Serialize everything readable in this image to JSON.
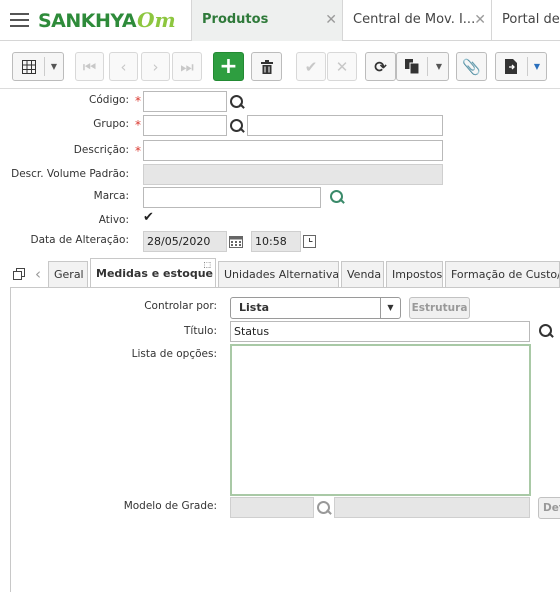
{
  "header": {
    "logo_main": "SANKHYA",
    "logo_suffix": "Om",
    "tabs": [
      {
        "label": "Produtos",
        "active": true
      },
      {
        "label": "Central de Mov. I...",
        "active": false
      },
      {
        "label": "Portal de M",
        "active": false
      }
    ],
    "close_glyph": "✕"
  },
  "toolbar": {
    "buttons": [
      "grid-view",
      "first",
      "previous",
      "next",
      "last",
      "add",
      "delete",
      "confirm",
      "cancel",
      "refresh",
      "duplicate",
      "attach",
      "export"
    ],
    "accent_green": "#2e9e40"
  },
  "form": {
    "codigo": {
      "label": "Código:",
      "value": ""
    },
    "grupo": {
      "label": "Grupo:",
      "value": "",
      "desc": ""
    },
    "descricao": {
      "label": "Descrição:",
      "value": ""
    },
    "descr_volume": {
      "label": "Descr. Volume Padrão:",
      "value": ""
    },
    "marca": {
      "label": "Marca:",
      "value": ""
    },
    "ativo": {
      "label": "Ativo:",
      "checked": true,
      "check_glyph": "✔"
    },
    "data_alteracao": {
      "label": "Data de Alteração:",
      "date": "28/05/2020",
      "time": "10:58"
    },
    "required_mark": "*"
  },
  "subtabs": [
    {
      "label": "Geral",
      "active": false
    },
    {
      "label": "Medidas e estoque",
      "active": true
    },
    {
      "label": "Unidades Alternativas",
      "active": false
    },
    {
      "label": "Venda",
      "active": false
    },
    {
      "label": "Impostos",
      "active": false
    },
    {
      "label": "Formação de Custo/Pr",
      "active": false
    }
  ],
  "panel": {
    "controlar_por": {
      "label": "Controlar por:",
      "value": "Lista",
      "button": "Estrutura"
    },
    "titulo": {
      "label": "Título:",
      "value": "Status"
    },
    "lista_opcoes": {
      "label": "Lista de opções:",
      "value": ""
    },
    "modelo_grade": {
      "label": "Modelo de Grade:",
      "value": "",
      "button": "Def"
    }
  }
}
